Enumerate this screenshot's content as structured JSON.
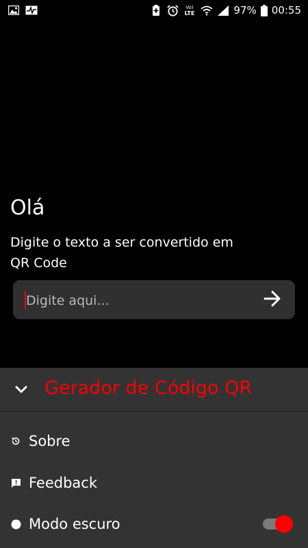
{
  "status_bar": {
    "battery_percent": "97%",
    "time": "00:55",
    "network_label": "Vo) LTE"
  },
  "main": {
    "greeting": "Olá",
    "instruction": "Digite o texto a ser convertido em QR Code",
    "input": {
      "value": "",
      "placeholder": "Digite aqui..."
    }
  },
  "sheet": {
    "title": "Gerador de Código QR",
    "items": [
      {
        "label": "Sobre",
        "icon": "history-icon"
      },
      {
        "label": "Feedback",
        "icon": "feedback-icon"
      },
      {
        "label": "Modo escuro",
        "icon": "dot-icon"
      }
    ],
    "dark_mode_enabled": true
  },
  "colors": {
    "accent": "#ff0000",
    "background": "#000000",
    "sheet_background": "#333333",
    "input_background": "#303030"
  }
}
